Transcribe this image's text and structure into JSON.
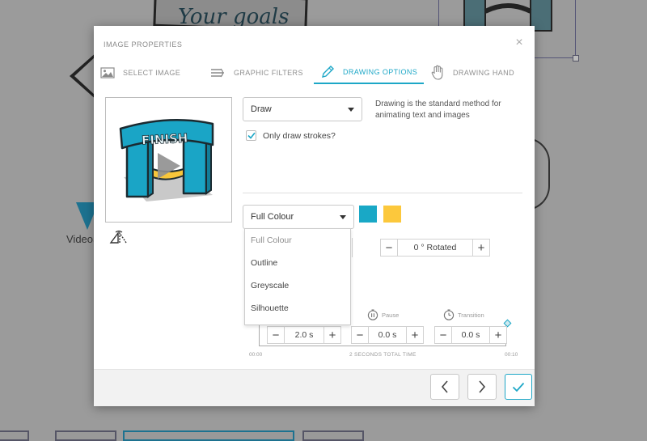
{
  "background": {
    "sign_text": "Your goals",
    "logo_text": "VideoS"
  },
  "modal": {
    "title": "IMAGE PROPERTIES",
    "tabs": [
      {
        "label": "SELECT IMAGE",
        "icon": "image-icon"
      },
      {
        "label": "GRAPHIC FILTERS",
        "icon": "filters-icon"
      },
      {
        "label": "DRAWING OPTIONS",
        "icon": "pencil-icon",
        "active": true
      },
      {
        "label": "DRAWING HAND",
        "icon": "hand-icon"
      }
    ],
    "preview": {
      "sign_text": "FINISH"
    },
    "draw_method": {
      "selected": "Draw",
      "description": "Drawing is the standard method for animating text and images"
    },
    "only_strokes": {
      "label": "Only draw strokes?",
      "checked": true
    },
    "colour_mode": {
      "selected": "Full Colour",
      "options": [
        "Full Colour",
        "Outline",
        "Greyscale",
        "Silhouette"
      ]
    },
    "swatches": [
      "#19a8c6",
      "#fcc83c"
    ],
    "rotation": {
      "value": "0 ° Rotated"
    },
    "timing": {
      "draw": "2.0 s",
      "pause_label": "Pause",
      "pause": "0.0 s",
      "transition_label": "Transition",
      "transition": "0.0 s",
      "start_time": "00:00",
      "end_time": "00:10",
      "total_label": "2 SECONDS TOTAL TIME"
    }
  },
  "colors": {
    "accent": "#1da7c7",
    "swatch_blue": "#19a8c6",
    "swatch_yellow": "#fcc83c"
  }
}
